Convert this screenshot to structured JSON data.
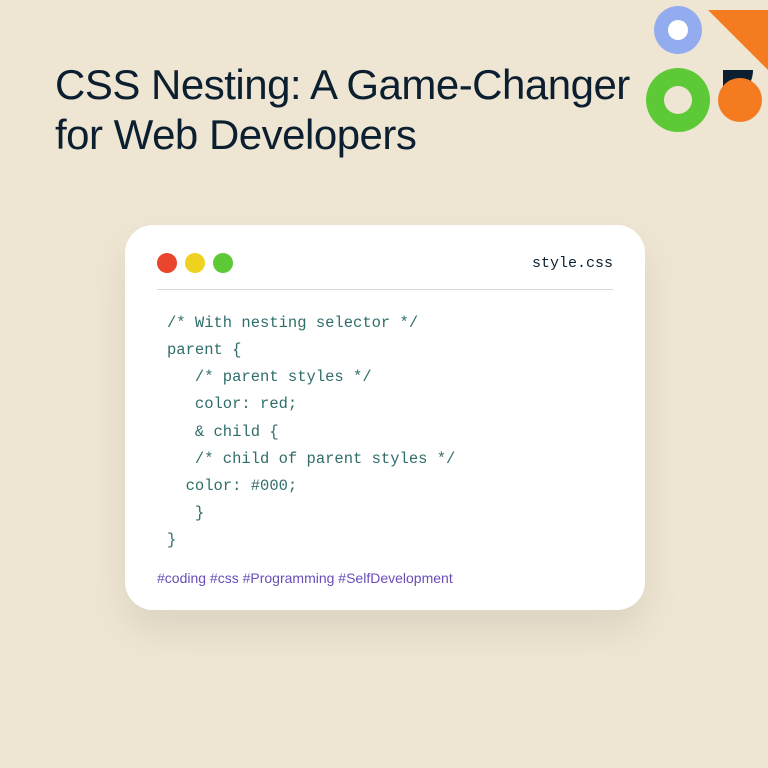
{
  "title": "CSS Nesting: A Game-Changer for Web Developers",
  "card": {
    "filename": "style.css",
    "code_lines": [
      "/* With nesting selector */",
      "parent {",
      "   /* parent styles */",
      "   color: red;",
      "   & child {",
      "   /* child of parent styles */",
      "  color: #000;",
      "   }",
      "}"
    ],
    "hashtags": "#coding #css #Programming #SelfDevelopment"
  },
  "colors": {
    "bg": "#eee5d2",
    "dark": "#0c1f30",
    "code": "#2f6d6a",
    "hashtag": "#6b4db8",
    "trafficRed": "#e8452c",
    "trafficYellow": "#efd220",
    "trafficGreen": "#5dc937",
    "accentOrange": "#f47b20",
    "accentGreen": "#5dc937",
    "accentBlue": "#93acf0"
  }
}
